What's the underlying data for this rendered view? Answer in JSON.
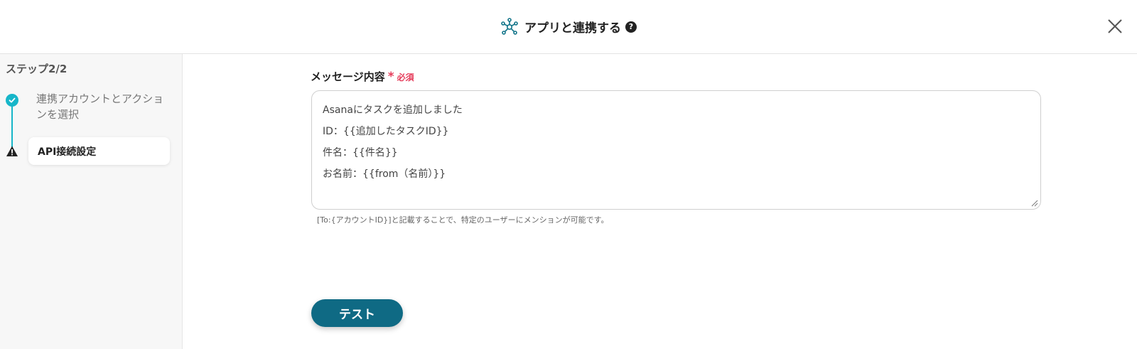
{
  "header": {
    "title": "アプリと連携する",
    "help_symbol": "?",
    "title_icon": "network-hub-icon",
    "close_icon": "close-icon"
  },
  "sidebar": {
    "step_count": "ステップ2/2",
    "steps": [
      {
        "label": "連携アカウントとアクションを選択",
        "status": "completed",
        "icon": "check-circle-icon"
      },
      {
        "label": "API接続設定",
        "status": "warning",
        "icon": "warning-triangle-icon"
      }
    ]
  },
  "form": {
    "message_label": "メッセージ内容",
    "required_mark": "*",
    "required_text": "必須",
    "message_lines": [
      "Asanaにタスクを追加しました",
      "ID：{{追加したタスクID}}",
      "件名：{{件名}}",
      "お名前：{{from（名前）}}"
    ],
    "hint": "[To:{アカウントID}]と記載することで、特定のユーザーにメンションが可能です。"
  },
  "actions": {
    "test_label": "テスト"
  },
  "colors": {
    "accent": "#17b6c9",
    "primary_button": "#0f6a84",
    "required": "#e53c5a"
  }
}
